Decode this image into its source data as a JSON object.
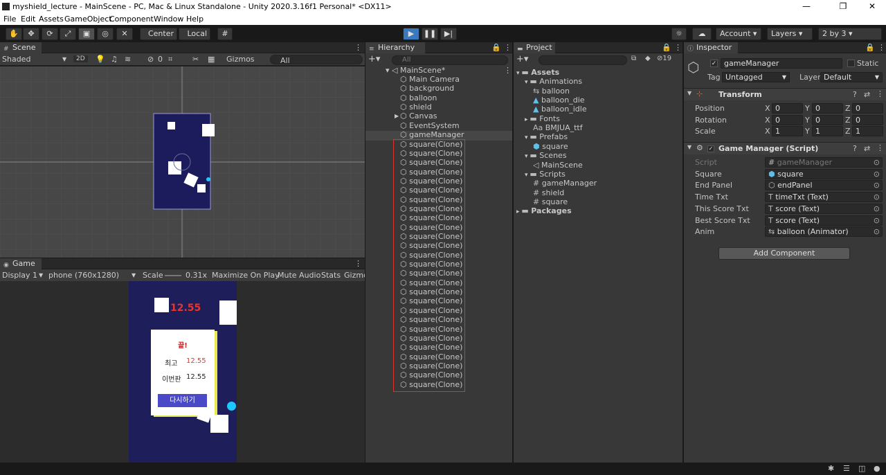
{
  "window": {
    "title": "myshield_lecture - MainScene - PC, Mac & Linux Standalone - Unity 2020.3.16f1 Personal* <DX11>"
  },
  "menu": [
    "File",
    "Edit",
    "Assets",
    "GameObject",
    "Component",
    "Window",
    "Help"
  ],
  "toolbar": {
    "center_label": "Center",
    "local_label": "Local",
    "account_label": "Account",
    "layers_label": "Layers",
    "layout_label": "2 by 3"
  },
  "scene": {
    "tab_label": "Scene",
    "shading": "Shaded",
    "mode_2d": "2D",
    "hidden_count": "0",
    "gizmos_label": "Gizmos",
    "search_placeholder": "All"
  },
  "game": {
    "tab_label": "Game",
    "display": "Display 1",
    "resolution": "phone (760x1280)",
    "scale_label": "Scale",
    "scale_value": "0.31x",
    "maximize": "Maximize On Play",
    "mute": "Mute Audio",
    "stats": "Stats",
    "gizmos": "Gizmo",
    "timer": "12.55",
    "panel": {
      "title": "끝!",
      "best_label": "최고",
      "best_value": "12.55",
      "this_label": "이번판",
      "this_value": "12.55",
      "retry_button": "다시하기"
    }
  },
  "hierarchy": {
    "tab_label": "Hierarchy",
    "search_placeholder": "All",
    "scene_name": "MainScene*",
    "items": [
      "Main Camera",
      "background",
      "balloon",
      "shield",
      "Canvas",
      "EventSystem",
      "gameManager"
    ],
    "clones": [
      "square(Clone)",
      "square(Clone)",
      "square(Clone)",
      "square(Clone)",
      "square(Clone)",
      "square(Clone)",
      "square(Clone)",
      "square(Clone)",
      "square(Clone)",
      "square(Clone)",
      "square(Clone)",
      "square(Clone)",
      "square(Clone)",
      "square(Clone)",
      "square(Clone)",
      "square(Clone)",
      "square(Clone)",
      "square(Clone)",
      "square(Clone)",
      "square(Clone)",
      "square(Clone)",
      "square(Clone)",
      "square(Clone)",
      "square(Clone)",
      "square(Clone)",
      "square(Clone)",
      "square(Clone)"
    ]
  },
  "project": {
    "tab_label": "Project",
    "hidden_count": "19",
    "tree": [
      {
        "label": "Assets",
        "type": "folder"
      },
      {
        "label": "Animations",
        "type": "folder"
      },
      {
        "label": "balloon",
        "type": "anim"
      },
      {
        "label": "balloon_die",
        "type": "clip"
      },
      {
        "label": "balloon_idle",
        "type": "clip"
      },
      {
        "label": "Fonts",
        "type": "folder"
      },
      {
        "label": "BMJUA_ttf",
        "type": "font"
      },
      {
        "label": "Prefabs",
        "type": "folder"
      },
      {
        "label": "square",
        "type": "prefab"
      },
      {
        "label": "Scenes",
        "type": "folder"
      },
      {
        "label": "MainScene",
        "type": "scene"
      },
      {
        "label": "Scripts",
        "type": "folder"
      },
      {
        "label": "gameManager",
        "type": "script"
      },
      {
        "label": "shield",
        "type": "script"
      },
      {
        "label": "square",
        "type": "script"
      },
      {
        "label": "Packages",
        "type": "folder"
      }
    ]
  },
  "inspector": {
    "tab_label": "Inspector",
    "object_name": "gameManager",
    "static_label": "Static",
    "tag_label": "Tag",
    "tag_value": "Untagged",
    "layer_label": "Layer",
    "layer_value": "Default",
    "transform": {
      "title": "Transform",
      "position_label": "Position",
      "rotation_label": "Rotation",
      "scale_label": "Scale",
      "position": [
        "0",
        "0",
        "0"
      ],
      "rotation": [
        "0",
        "0",
        "0"
      ],
      "scale": [
        "1",
        "1",
        "1"
      ]
    },
    "component": {
      "title": "Game Manager (Script)",
      "fields": [
        {
          "label": "Script",
          "value": "gameManager"
        },
        {
          "label": "Square",
          "value": "square"
        },
        {
          "label": "End Panel",
          "value": "endPanel"
        },
        {
          "label": "Time Txt",
          "value": "timeTxt (Text)"
        },
        {
          "label": "This Score Txt",
          "value": "score (Text)"
        },
        {
          "label": "Best Score Txt",
          "value": "score (Text)"
        },
        {
          "label": "Anim",
          "value": "balloon (Animator)"
        }
      ]
    },
    "add_component": "Add Component"
  },
  "colors": {
    "accent": "#3a79bb",
    "highlight_box": "#e0322a",
    "game_bg": "#1e1e5a",
    "timer_red": "#e8352c",
    "balloon_cyan": "#1ec8ff"
  }
}
